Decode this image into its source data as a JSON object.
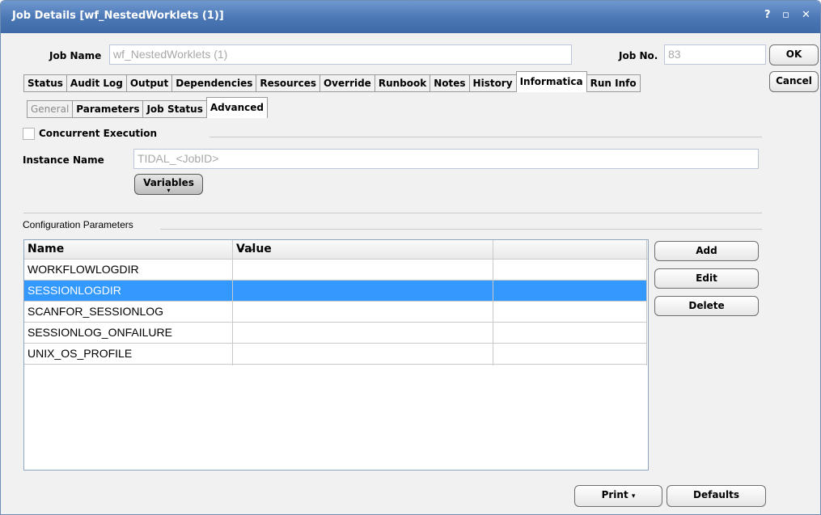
{
  "window": {
    "title": "Job Details [wf_NestedWorklets (1)]",
    "controls": [
      "?",
      "▫",
      "✕"
    ]
  },
  "job": {
    "name_label": "Job Name",
    "name_value": "wf_NestedWorklets (1)",
    "no_label": "Job No.",
    "no_value": "83"
  },
  "buttons": {
    "ok": "OK",
    "cancel": "Cancel",
    "variables": "Variables",
    "add": "Add",
    "edit": "Edit",
    "delete": "Delete",
    "print": "Print",
    "defaults": "Defaults"
  },
  "main_tabs": [
    "Status",
    "Audit Log",
    "Output",
    "Dependencies",
    "Resources",
    "Override",
    "Runbook",
    "Notes",
    "History",
    "Informatica",
    "Run Info"
  ],
  "main_tab_active": "Informatica",
  "sub_tabs": [
    "General",
    "Parameters",
    "Job Status",
    "Advanced"
  ],
  "sub_tab_active": "Advanced",
  "advanced": {
    "concurrent_label": "Concurrent Execution",
    "concurrent_checked": false,
    "instance_label": "Instance Name",
    "instance_value": "TIDAL_<JobID>"
  },
  "config": {
    "section_label": "Configuration Parameters",
    "columns": [
      "Name",
      "Value",
      ""
    ],
    "rows": [
      {
        "name": "WORKFLOWLOGDIR",
        "value": ""
      },
      {
        "name": "SESSIONLOGDIR",
        "value": "",
        "selected": true
      },
      {
        "name": "SCANFOR_SESSIONLOG",
        "value": ""
      },
      {
        "name": "SESSIONLOG_ONFAILURE",
        "value": ""
      },
      {
        "name": "UNIX_OS_PROFILE",
        "value": ""
      }
    ],
    "selected_color": "#3399ff"
  },
  "colors": {
    "titlebar": "#4a76b4",
    "background": "#f1f1f1"
  }
}
